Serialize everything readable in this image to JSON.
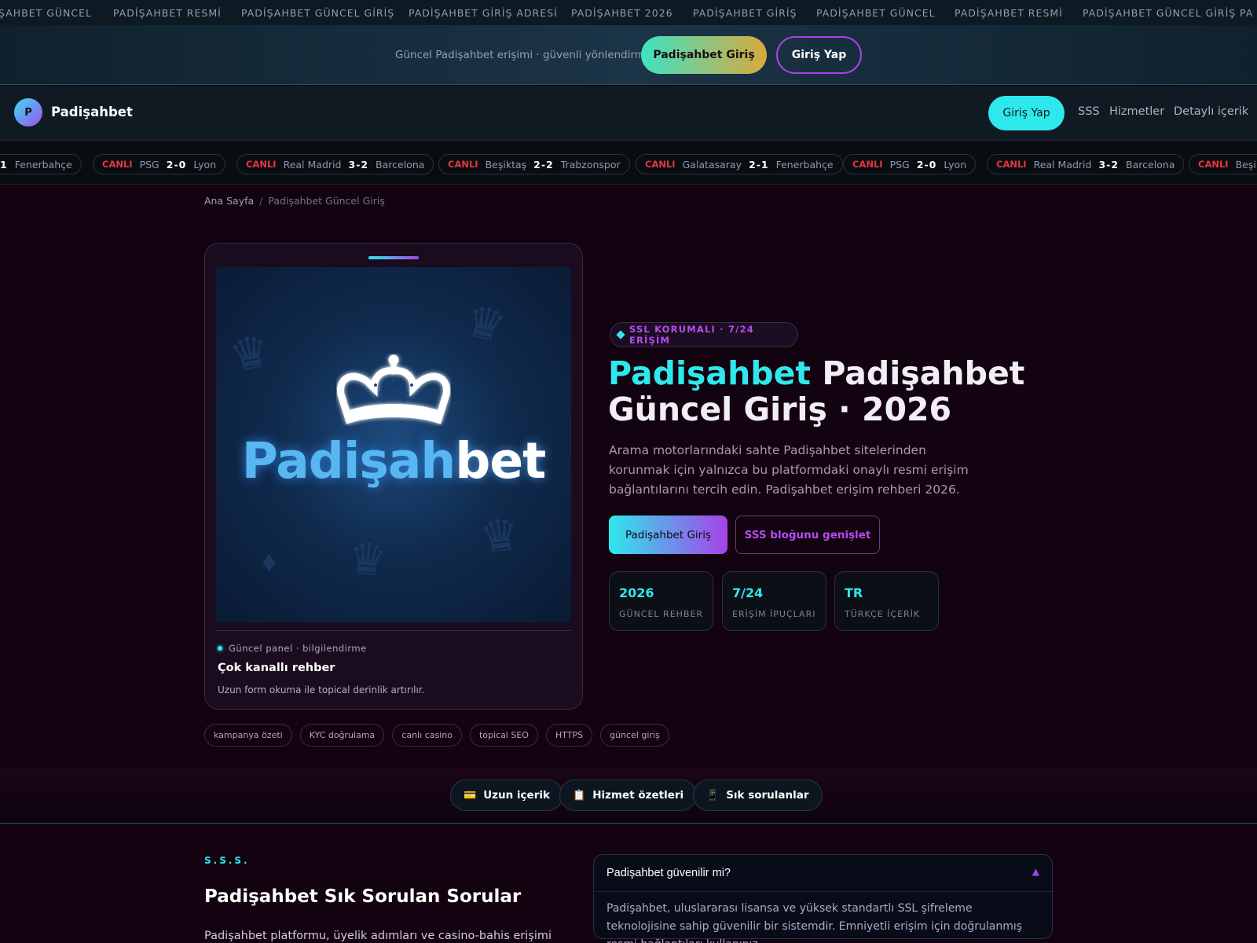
{
  "ticker": {
    "items": [
      "ŞAHBET GÜNCEL",
      "PADİŞAHBET RESMİ",
      "PADİŞAHBET GÜNCEL GİRİŞ",
      "PADİŞAHBET GİRİŞ ADRESİ",
      "PADİŞAHBET 2026",
      "PADİŞAHBET GİRİŞ",
      "PADİŞAHBET GÜNCEL",
      "PADİŞAHBET RESMİ",
      "PADİŞAHBET GÜNCEL GİRİŞ",
      "PA"
    ]
  },
  "topbar": {
    "text": "Güncel Padişahbet erişimi · güvenli yönlendirme",
    "primary_label": "Padişahbet Giriş",
    "secondary_label": "Giriş Yap"
  },
  "nav": {
    "logo_letter": "P",
    "brand": "Padişahbet",
    "login_label": "Giriş Yap",
    "links": [
      "SSS",
      "Hizmetler",
      "Detaylı içerik"
    ]
  },
  "scores": [
    {
      "live": "",
      "home": "1",
      "score": "",
      "away": "Fenerbahçe"
    },
    {
      "live": "CANLI",
      "home": "PSG",
      "score": "2-0",
      "away": "Lyon"
    },
    {
      "live": "CANLI",
      "home": "Real Madrid",
      "score": "3-2",
      "away": "Barcelona"
    },
    {
      "live": "CANLI",
      "home": "Beşiktaş",
      "score": "2-2",
      "away": "Trabzonspor"
    },
    {
      "live": "CANLI",
      "home": "Galatasaray",
      "score": "2-1",
      "away": "Fenerbahçe"
    },
    {
      "live": "CANLI",
      "home": "PSG",
      "score": "2-0",
      "away": "Lyon"
    },
    {
      "live": "CANLI",
      "home": "Real Madrid",
      "score": "3-2",
      "away": "Barcelona"
    },
    {
      "live": "CANLI",
      "home": "Beşikt",
      "score": "",
      "away": ""
    }
  ],
  "breadcrumb": {
    "home": "Ana Sayfa",
    "separator": "/",
    "current": "Padişahbet Güncel Giriş"
  },
  "card": {
    "brand_part1": "Padişah",
    "brand_part2": "bet",
    "meta": "Güncel panel · bilgilendirme",
    "title": "Çok kanallı rehber",
    "subtitle": "Uzun form okuma ile topical derinlik artırılır."
  },
  "tags": [
    "kampanya özeti",
    "KYC doğrulama",
    "canlı casino",
    "topical SEO",
    "HTTPS",
    "güncel giriş"
  ],
  "hero": {
    "badge": "SSL KORUMALI · 7/24 ERİŞİM",
    "title_accent": "Padişahbet",
    "title_rest": " Padişahbet Güncel Giriş · 2026",
    "lead": "Arama motorlarındaki sahte Padişahbet sitelerinden korunmak için yalnızca bu platformdaki onaylı resmi erişim bağlantılarını tercih edin. Padişahbet erişim rehberi 2026.",
    "cta_primary": "Padişahbet Giriş",
    "cta_secondary": "SSS bloğunu genişlet",
    "stats": [
      {
        "value": "2026",
        "label": "GÜNCEL REHBER"
      },
      {
        "value": "7/24",
        "label": "ERİŞİM İPUÇLARI"
      },
      {
        "value": "TR",
        "label": "TÜRKÇE İÇERİK"
      }
    ]
  },
  "chips": [
    {
      "icon": "💳",
      "label": "Uzun içerik"
    },
    {
      "icon": "📋",
      "label": "Hizmet özetleri"
    },
    {
      "icon": "📱",
      "label": "Sık sorulanlar"
    }
  ],
  "faq_section": {
    "eyebrow": "S.S.S.",
    "title": "Padişahbet Sık Sorulan Sorular",
    "intro": "Padişahbet platformu, üyelik adımları ve casino-bahis erişimi"
  },
  "faq": {
    "question": "Padişahbet güvenilir mi?",
    "arrow": "▲",
    "answer": "Padişahbet, uluslararası lisansa ve yüksek standartlı SSL şifreleme teknolojisine sahip güvenilir bir sistemdir. Emniyetli erişim için doğrulanmış resmi bağlantıları kullanınız."
  },
  "colors": {
    "accent_cyan": "#2ee8ec",
    "accent_purple": "#a742e8",
    "live_red": "#e8363c",
    "background": "#13020f"
  }
}
